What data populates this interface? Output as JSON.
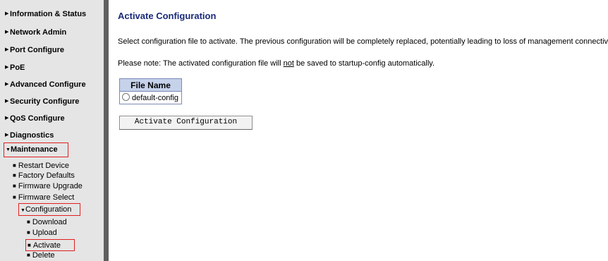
{
  "sidebar": {
    "items": [
      {
        "label": "Information & Status",
        "icon": "triangle-right-icon"
      },
      {
        "label": "Network Admin",
        "icon": "triangle-right-icon"
      },
      {
        "label": "Port Configure",
        "icon": "triangle-right-icon"
      },
      {
        "label": "PoE",
        "icon": "triangle-right-icon"
      },
      {
        "label": "Advanced Configure",
        "icon": "triangle-right-icon"
      },
      {
        "label": "Security Configure",
        "icon": "triangle-right-icon"
      },
      {
        "label": "QoS Configure",
        "icon": "triangle-right-icon"
      },
      {
        "label": "Diagnostics",
        "icon": "triangle-right-icon"
      },
      {
        "label": "Maintenance",
        "icon": "triangle-down-icon"
      }
    ],
    "maintenance_sub": [
      "Restart Device",
      "Factory Defaults",
      "Firmware Upgrade",
      "Firmware Select",
      "Configuration"
    ],
    "configuration_sub": [
      "Download",
      "Upload",
      "Activate",
      "Delete"
    ]
  },
  "main": {
    "title": "Activate Configuration",
    "description": "Select configuration file to activate. The previous configuration will be completely replaced, potentially leading to loss of management connectivity",
    "note_prefix": "Please note: The activated configuration file will ",
    "note_emphasis": "not",
    "note_suffix": " be saved to startup-config automatically.",
    "table": {
      "header": "File Name",
      "rows": [
        "default-config"
      ]
    },
    "activate_button": "Activate Configuration"
  },
  "colors": {
    "title": "#1a2a7a",
    "highlight_border": "#e02020",
    "sidebar_bg": "#e5e5e5",
    "divider": "#5f5f5f",
    "table_header_bg": "#c5d2ea"
  }
}
